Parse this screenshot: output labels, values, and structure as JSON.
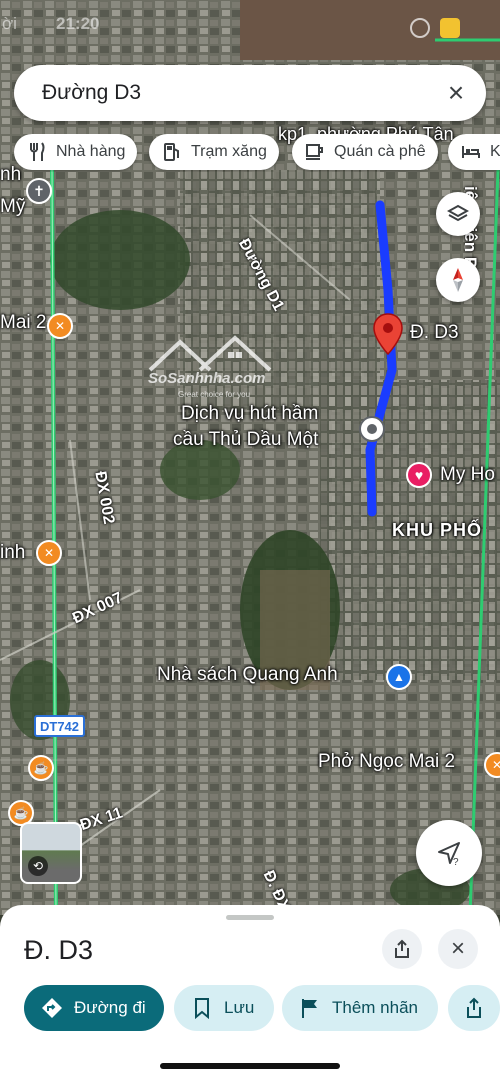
{
  "status": {
    "time": "21:20",
    "left_fragment": "ời"
  },
  "search": {
    "value": "Đường D3"
  },
  "chips": [
    {
      "label": "Nhà hàng",
      "icon": "fork-knife-icon"
    },
    {
      "label": "Trạm xăng",
      "icon": "gas-station-icon"
    },
    {
      "label": "Quán cà phê",
      "icon": "coffee-cup-icon"
    },
    {
      "label": "Kh",
      "icon": "bed-icon"
    }
  ],
  "map_labels": {
    "top_area": "kp1, phường Phú Tân",
    "road_d1": "Đường D1",
    "road_bienphu": "iện Biên Phủ",
    "selected": "Đ. D3",
    "poi_septic_1": "Dịch vụ hút hầm",
    "poi_septic_2": "cầu Thủ Dầu Một",
    "poi_myhome": "My Ho",
    "district": "KHU PHỐ",
    "dx002": "ĐX 002",
    "dx007": "ĐX 007",
    "bookstore": "Nhà sách Quang Anh",
    "pho": "Phở Ngọc Mai 2",
    "dx11": "ĐX 11",
    "dxbottom": "Đ. ĐX",
    "left_mai2": "Mai 2",
    "left_my": "Mỹ",
    "left_nh": "nh",
    "left_inh": "inh",
    "shield": "DT742",
    "watermark": "SoSanhnha.com",
    "watermark_sub": "Great choice for you"
  },
  "sheet": {
    "title": "Đ. D3",
    "actions": [
      {
        "label": "Đường đi",
        "icon": "directions-icon"
      },
      {
        "label": "Lưu",
        "icon": "bookmark-icon"
      },
      {
        "label": "Thêm nhãn",
        "icon": "flag-icon"
      }
    ]
  },
  "colors": {
    "route": "#1a3cff",
    "marker": "#ea4335",
    "primary": "#0b6b7a",
    "highway": "#2ecc71"
  }
}
